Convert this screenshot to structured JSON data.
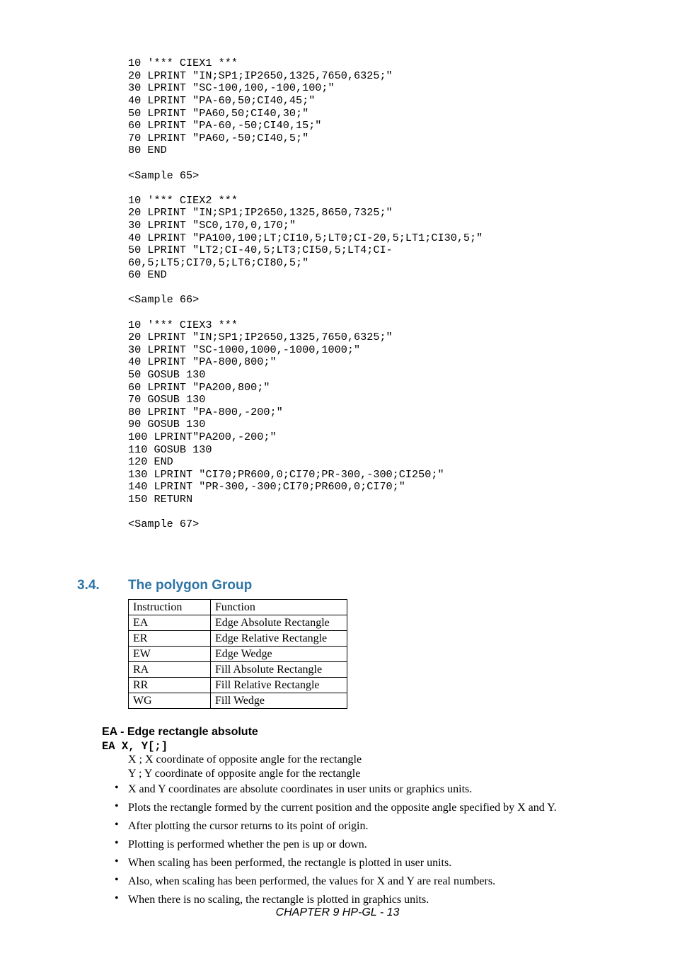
{
  "code": {
    "block": "10 '*** CIEX1 ***\n20 LPRINT \"IN;SP1;IP2650,1325,7650,6325;\"\n30 LPRINT \"SC-100,100,-100,100;\"\n40 LPRINT \"PA-60,50;CI40,45;\"\n50 LPRINT \"PA60,50;CI40,30;\"\n60 LPRINT \"PA-60,-50;CI40,15;\"\n70 LPRINT \"PA60,-50;CI40,5;\"\n80 END\n\n<Sample 65>\n\n10 '*** CIEX2 ***\n20 LPRINT \"IN;SP1;IP2650,1325,8650,7325;\"\n30 LPRINT \"SC0,170,0,170;\"\n40 LPRINT \"PA100,100;LT;CI10,5;LT0;CI-20,5;LT1;CI30,5;\"\n50 LPRINT \"LT2;CI-40,5;LT3;CI50,5;LT4;CI-\n60,5;LT5;CI70,5;LT6;CI80,5;\"\n60 END\n\n<Sample 66>\n\n10 '*** CIEX3 ***\n20 LPRINT \"IN;SP1;IP2650,1325,7650,6325;\"\n30 LPRINT \"SC-1000,1000,-1000,1000;\"\n40 LPRINT \"PA-800,800;\"\n50 GOSUB 130\n60 LPRINT \"PA200,800;\"\n70 GOSUB 130\n80 LPRINT \"PA-800,-200;\"\n90 GOSUB 130\n100 LPRINT\"PA200,-200;\"\n110 GOSUB 130\n120 END\n130 LPRINT \"CI70;PR600,0;CI70;PR-300,-300;CI250;\"\n140 LPRINT \"PR-300,-300;CI70;PR600,0;CI70;\"\n150 RETURN\n\n<Sample 67>"
  },
  "section": {
    "num": "3.4.",
    "title": "The polygon Group"
  },
  "table": {
    "head": {
      "c1": "Instruction",
      "c2": "Function"
    },
    "rows": [
      {
        "c1": "EA",
        "c2": "Edge Absolute Rectangle"
      },
      {
        "c1": "ER",
        "c2": "Edge Relative Rectangle"
      },
      {
        "c1": "EW",
        "c2": "Edge Wedge"
      },
      {
        "c1": "RA",
        "c2": "Fill Absolute Rectangle"
      },
      {
        "c1": "RR",
        "c2": "Fill Relative Rectangle"
      },
      {
        "c1": "WG",
        "c2": "Fill Wedge"
      }
    ]
  },
  "ea": {
    "heading": "EA - Edge rectangle absolute",
    "syntax": "EA X, Y[;]",
    "param1": "X ; X coordinate of opposite angle for the rectangle",
    "param2": "Y ; Y coordinate of opposite angle for the rectangle",
    "b1": "X and Y coordinates are absolute coordinates in user units or graphics units.",
    "b2": "Plots the rectangle formed by the current position and the opposite angle specified by X and Y.",
    "b3": "After plotting the cursor returns to its point of origin.",
    "b4": "Plotting is performed whether the pen is up or down.",
    "b5": "When scaling has been performed, the rectangle is plotted in user units.",
    "b6": "Also, when scaling has been performed, the values for X and Y are real numbers.",
    "b7": "When there is no scaling, the rectangle is plotted in graphics units."
  },
  "footer": "CHAPTER 9 HP-GL - 13",
  "bullet": "•"
}
